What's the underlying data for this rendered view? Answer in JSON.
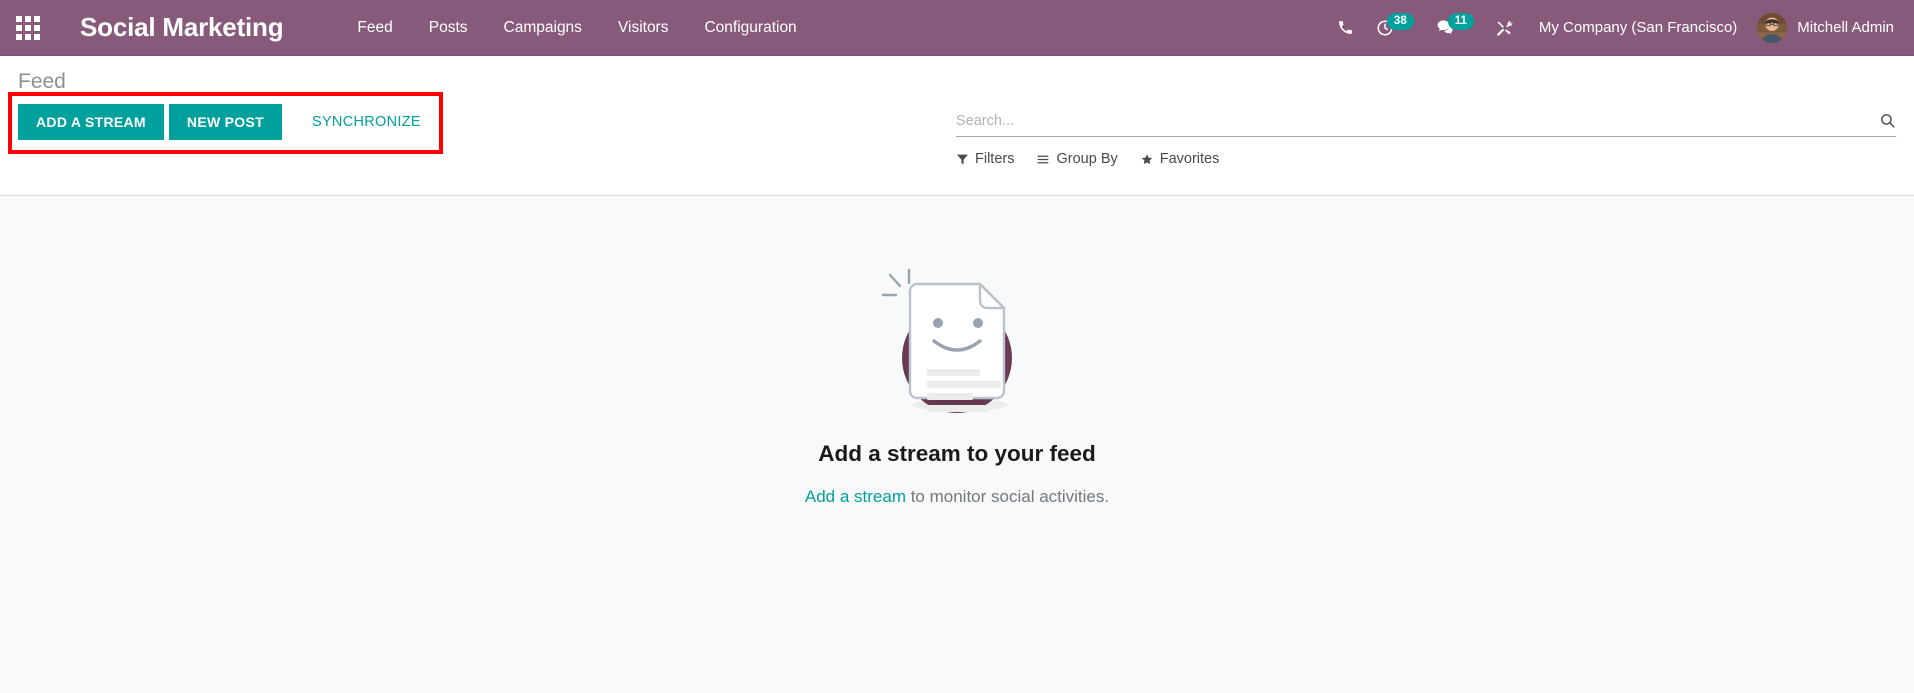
{
  "navbar": {
    "apps_icon": "apps-grid-icon",
    "brand": "Social Marketing",
    "menu_items": [
      {
        "label": "Feed"
      },
      {
        "label": "Posts"
      },
      {
        "label": "Campaigns"
      },
      {
        "label": "Visitors"
      },
      {
        "label": "Configuration"
      }
    ],
    "icons": [
      {
        "name": "phone-icon"
      },
      {
        "name": "activity-clock-icon",
        "badge": "38"
      },
      {
        "name": "messages-chat-icon",
        "badge": "11"
      },
      {
        "name": "developer-tools-icon"
      }
    ],
    "company": "My Company (San Francisco)",
    "username": "Mitchell Admin",
    "background_color": "#875a7b",
    "badge_color": "#00a09d"
  },
  "control_panel": {
    "breadcrumb": "Feed",
    "add_stream_label": "ADD A STREAM",
    "new_post_label": "NEW POST",
    "synchronize_label": "SYNCHRONIZE",
    "primary_color": "#00a09d",
    "highlight_color": "#ff0000",
    "search": {
      "placeholder": "Search...",
      "value": "",
      "icon": "search-icon"
    },
    "filters": [
      {
        "label": "Filters",
        "icon": "filter-funnel-icon"
      },
      {
        "label": "Group By",
        "icon": "group-by-lines-icon"
      },
      {
        "label": "Favorites",
        "icon": "star-icon"
      }
    ]
  },
  "content": {
    "empty_state": {
      "illustration": "smiling-document-icon",
      "title": "Add a stream to your feed",
      "subtitle_link": "Add a stream",
      "subtitle_rest": " to monitor social activities.",
      "link_color": "#00a09d"
    }
  }
}
